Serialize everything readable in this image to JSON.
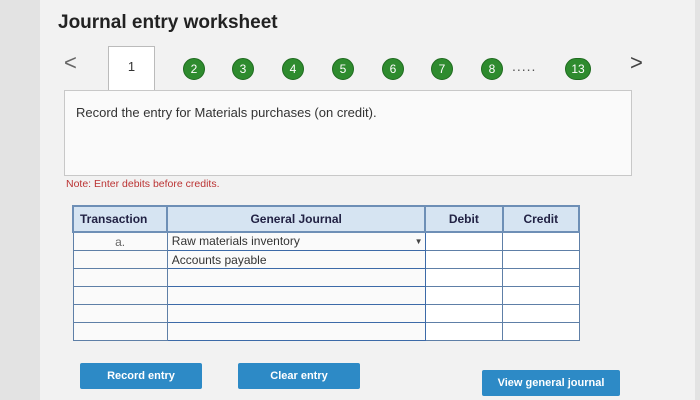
{
  "title": "Journal entry worksheet",
  "nav": {
    "prev": "<",
    "next": ">",
    "active_tab": "1",
    "steps": [
      "2",
      "3",
      "4",
      "5",
      "6",
      "7",
      "8"
    ],
    "ellipsis": ".....",
    "last_step": "13"
  },
  "instruction": "Record the entry for Materials purchases (on credit).",
  "note": "Note: Enter debits before credits.",
  "table": {
    "headers": {
      "transaction": "Transaction",
      "general_journal": "General Journal",
      "debit": "Debit",
      "credit": "Credit"
    },
    "rows": [
      {
        "transaction": "a.",
        "account": "Raw materials inventory",
        "debit": "",
        "credit": ""
      },
      {
        "transaction": "",
        "account": "Accounts payable",
        "debit": "",
        "credit": ""
      },
      {
        "transaction": "",
        "account": "",
        "debit": "",
        "credit": ""
      },
      {
        "transaction": "",
        "account": "",
        "debit": "",
        "credit": ""
      },
      {
        "transaction": "",
        "account": "",
        "debit": "",
        "credit": ""
      },
      {
        "transaction": "",
        "account": "",
        "debit": "",
        "credit": ""
      }
    ]
  },
  "buttons": {
    "record": "Record entry",
    "clear": "Clear entry",
    "view": "View general journal"
  },
  "colors": {
    "step_green": "#2e8b2e",
    "button_blue": "#2d8ac6",
    "header_blue": "#d6e4f2"
  }
}
